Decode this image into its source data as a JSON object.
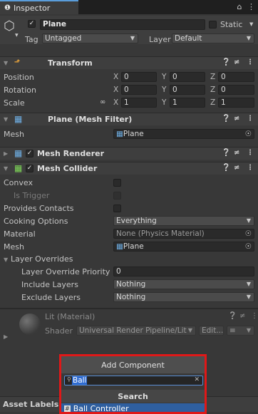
{
  "tab": {
    "title": "Inspector",
    "lock_icon": "lock-icon",
    "menu_icon": "kebab-menu-icon"
  },
  "object": {
    "name": "Plane",
    "active": true,
    "static_label": "Static",
    "tag_label": "Tag",
    "tag_value": "Untagged",
    "layer_label": "Layer",
    "layer_value": "Default"
  },
  "transform": {
    "title": "Transform",
    "position": {
      "label": "Position",
      "x": "0",
      "y": "0",
      "z": "0"
    },
    "rotation": {
      "label": "Rotation",
      "x": "0",
      "y": "0",
      "z": "0"
    },
    "scale": {
      "label": "Scale",
      "x": "1",
      "y": "1",
      "z": "1"
    }
  },
  "axes": {
    "x": "X",
    "y": "Y",
    "z": "Z"
  },
  "mesh_filter": {
    "title": "Plane (Mesh Filter)",
    "mesh_label": "Mesh",
    "mesh_value": "Plane"
  },
  "mesh_renderer": {
    "title": "Mesh Renderer"
  },
  "mesh_collider": {
    "title": "Mesh Collider",
    "convex_label": "Convex",
    "is_trigger_label": "Is Trigger",
    "provides_contacts_label": "Provides Contacts",
    "cooking_label": "Cooking Options",
    "cooking_value": "Everything",
    "material_label": "Material",
    "material_value": "None (Physics Material)",
    "mesh_label": "Mesh",
    "mesh_value": "Plane",
    "layer_overrides_label": "Layer Overrides",
    "priority_label": "Layer Override Priority",
    "priority_value": "0",
    "include_label": "Include Layers",
    "include_value": "Nothing",
    "exclude_label": "Exclude Layers",
    "exclude_value": "Nothing"
  },
  "material": {
    "name": "Lit (Material)",
    "shader_label": "Shader",
    "shader_value": "Universal Render Pipeline/Lit",
    "edit_label": "Edit..."
  },
  "asset_labels": "Asset Labels",
  "add_component": {
    "header": "Add Component",
    "search_value": "Ball",
    "title": "Search",
    "result": "Ball Controller"
  }
}
